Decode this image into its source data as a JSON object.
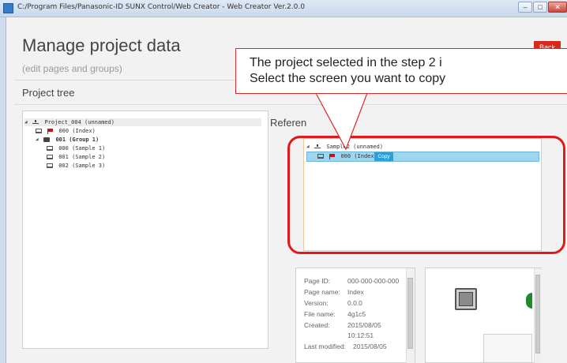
{
  "window": {
    "title": "C:/Program Files/Panasonic-ID SUNX Control/Web Creator - Web Creator Ver.2.0.0",
    "minimize": "–",
    "maximize": "□",
    "close": "✕"
  },
  "header": {
    "title": "Manage project data",
    "subtitle": "(edit pages and groups)",
    "back_label": "Back"
  },
  "project_tree": {
    "title": "Project tree",
    "root": "Project_004 (unnamed)",
    "index_page": "000 (Index)",
    "group": "001 (Group 1)",
    "pages": [
      "000 (Sample 1)",
      "001 (Sample 2)",
      "002 (Sample 3)"
    ]
  },
  "reference": {
    "label": "Referen",
    "root": "Sample2 (unnamed)",
    "index_page": "000 (Index)",
    "copy_label": "Copy"
  },
  "callout": {
    "line1": "The project selected in the step 2 i",
    "line2": "Select the screen you want to copy"
  },
  "details": {
    "page_id_label": "Page ID:",
    "page_id": "000-000-000-000",
    "page_name_label": "Page name:",
    "page_name": "Index",
    "version_label": "Version:",
    "version": "0.0.0",
    "file_name_label": "File name:",
    "file_name": "4g1c5",
    "created_label": "Created:",
    "created_date": "2015/08/05",
    "created_time": "10:12:51",
    "last_modified_label": "Last modified:",
    "last_modified": "2015/08/05"
  },
  "colors": {
    "accent_red": "#e01a1a",
    "copy_blue": "#27a1d8",
    "selection_blue": "#9fd6ef"
  }
}
